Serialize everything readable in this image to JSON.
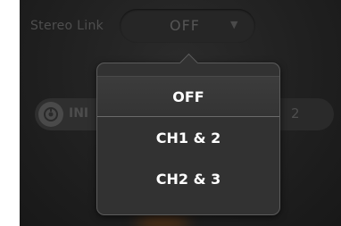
{
  "stereo_link": {
    "label": "Stereo Link",
    "value": "OFF",
    "arrow": "▼"
  },
  "input": {
    "icon": "input-jack-icon",
    "label": "INI"
  },
  "channel_number": "2",
  "dropdown": {
    "options": [
      {
        "label": "OFF",
        "selected": true
      },
      {
        "label": "CH1 & 2",
        "selected": false
      },
      {
        "label": "CH2 & 3",
        "selected": false
      }
    ]
  }
}
